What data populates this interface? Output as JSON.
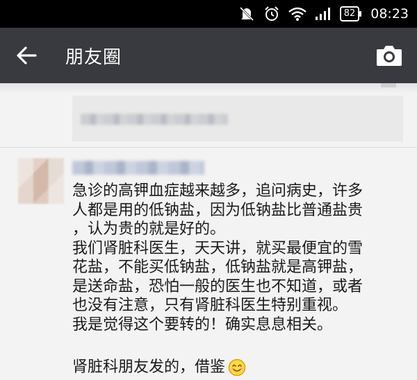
{
  "status_bar": {
    "time": "08:23",
    "battery": "82",
    "icons": [
      "mute-icon",
      "alarm-icon",
      "wifi-icon",
      "signal-icon",
      "battery-icon"
    ]
  },
  "header": {
    "title": "朋友圈",
    "back_icon": "back-arrow-icon",
    "camera_icon": "camera-icon",
    "background": "#393a3f"
  },
  "post": {
    "lines": [
      "急诊的高钾血症越来越多，追问病史，许多",
      "人都是用的低钠盐，因为低钠盐比普通盐贵",
      "，认为贵的就是好的。",
      "我们肾脏科医生，天天讲，就买最便宜的雪",
      "花盐，不能买低钠盐，低钠盐就是高钾盐，",
      "是送命盐，恐怕一般的医生也不知道，或者",
      "也没有注意，只有肾脏科医生特别重视。",
      "我是觉得这个要转的！确实息息相关。"
    ],
    "signature": "肾脏科朋友发的，借鉴",
    "emoji_icon": "smile-emoji-icon"
  }
}
